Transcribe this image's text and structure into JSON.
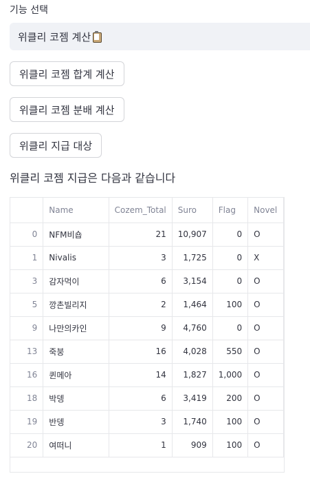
{
  "select": {
    "label": "기능 선택",
    "value": "위클리 코젬 계산",
    "icon": "clipboard-icon"
  },
  "buttons": [
    {
      "label": "위클리 코젬 합계 계산"
    },
    {
      "label": "위클리 코젬 분배 계산"
    },
    {
      "label": "위클리 지급 대상"
    }
  ],
  "caption": "위클리 코젬 지급은 다음과 같습니다",
  "table": {
    "columns": [
      "",
      "Name",
      "Cozem_Total",
      "Suro",
      "Flag",
      "Novel"
    ],
    "rows": [
      {
        "index": "0",
        "name": "NFM비숍",
        "cozem_total": "21",
        "suro": "10,907",
        "flag": "0",
        "novel": "O"
      },
      {
        "index": "1",
        "name": "Nivalis",
        "cozem_total": "3",
        "suro": "1,725",
        "flag": "0",
        "novel": "X"
      },
      {
        "index": "3",
        "name": "감자먹이",
        "cozem_total": "6",
        "suro": "3,154",
        "flag": "0",
        "novel": "O"
      },
      {
        "index": "5",
        "name": "깡촌빌리지",
        "cozem_total": "2",
        "suro": "1,464",
        "flag": "100",
        "novel": "O"
      },
      {
        "index": "9",
        "name": "나만의카인",
        "cozem_total": "9",
        "suro": "4,760",
        "flag": "0",
        "novel": "O"
      },
      {
        "index": "13",
        "name": "죽붕",
        "cozem_total": "16",
        "suro": "4,028",
        "flag": "550",
        "novel": "O"
      },
      {
        "index": "16",
        "name": "퀸메아",
        "cozem_total": "14",
        "suro": "1,827",
        "flag": "1,000",
        "novel": "O"
      },
      {
        "index": "18",
        "name": "박뎅",
        "cozem_total": "6",
        "suro": "3,419",
        "flag": "200",
        "novel": "O"
      },
      {
        "index": "19",
        "name": "반뎅",
        "cozem_total": "3",
        "suro": "1,740",
        "flag": "100",
        "novel": "O"
      },
      {
        "index": "20",
        "name": "여떠니",
        "cozem_total": "1",
        "suro": "909",
        "flag": "100",
        "novel": "O"
      }
    ]
  }
}
